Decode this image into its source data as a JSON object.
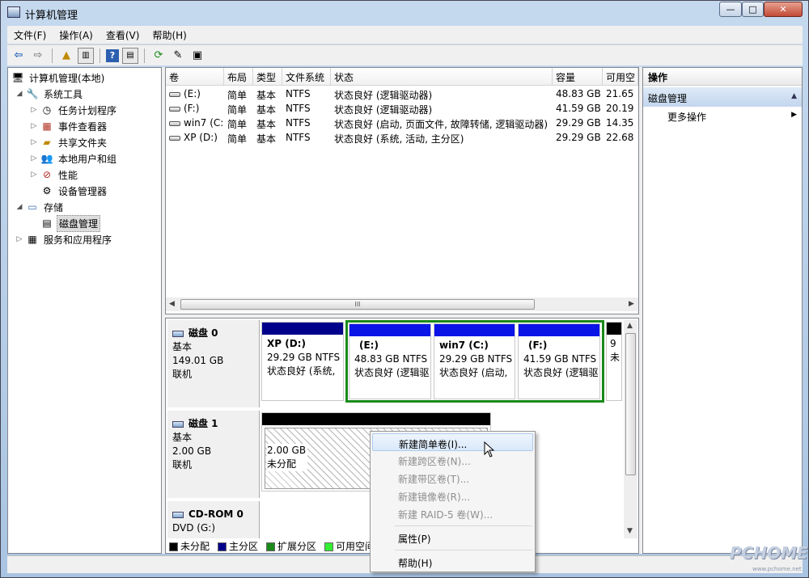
{
  "window": {
    "title": "计算机管理",
    "min": "—",
    "max": "□",
    "close": "✕"
  },
  "menu": [
    "文件(F)",
    "操作(A)",
    "查看(V)",
    "帮助(H)"
  ],
  "tree": [
    {
      "label": "计算机管理(本地)",
      "icon": "computer-icon"
    },
    {
      "label": "系统工具",
      "icon": "tools-icon",
      "exp": "◢"
    },
    {
      "label": "任务计划程序",
      "icon": "clock-icon",
      "exp": "▷"
    },
    {
      "label": "事件查看器",
      "icon": "event-viewer-icon",
      "exp": "▷"
    },
    {
      "label": "共享文件夹",
      "icon": "shared-folder-icon",
      "exp": "▷"
    },
    {
      "label": "本地用户和组",
      "icon": "users-icon",
      "exp": "▷"
    },
    {
      "label": "性能",
      "icon": "performance-icon",
      "exp": "▷"
    },
    {
      "label": "设备管理器",
      "icon": "device-manager-icon",
      "exp": ""
    },
    {
      "label": "存储",
      "icon": "storage-icon",
      "exp": "◢"
    },
    {
      "label": "磁盘管理",
      "icon": "disk-management-icon",
      "exp": ""
    },
    {
      "label": "服务和应用程序",
      "icon": "services-icon",
      "exp": "▷"
    }
  ],
  "volume_table": {
    "headers": [
      "卷",
      "布局",
      "类型",
      "文件系统",
      "状态",
      "容量",
      "可用空"
    ],
    "rows": [
      [
        "(E:)",
        "简单",
        "基本",
        "NTFS",
        "状态良好 (逻辑驱动器)",
        "48.83 GB",
        "21.65"
      ],
      [
        "(F:)",
        "简单",
        "基本",
        "NTFS",
        "状态良好 (逻辑驱动器)",
        "41.59 GB",
        "20.19"
      ],
      [
        "win7 (C:)",
        "简单",
        "基本",
        "NTFS",
        "状态良好 (启动, 页面文件, 故障转储, 逻辑驱动器)",
        "29.29 GB",
        "14.35"
      ],
      [
        "XP (D:)",
        "简单",
        "基本",
        "NTFS",
        "状态良好 (系统, 活动, 主分区)",
        "29.29 GB",
        "22.68"
      ]
    ],
    "scroll_thumb": "III"
  },
  "disks": {
    "disk0": {
      "name": "磁盘 0",
      "type": "基本",
      "size": "149.01 GB",
      "status": "联机"
    },
    "disk1": {
      "name": "磁盘 1",
      "type": "基本",
      "size": "2.00 GB",
      "status": "联机"
    },
    "cdrom": {
      "name": "CD-ROM 0",
      "type": "DVD (G:)"
    }
  },
  "partitions": [
    {
      "name": "XP  (D:)",
      "size": "29.29 GB NTFS",
      "status": "状态良好 (系统, "
    },
    {
      "name": "(E:)",
      "size": "48.83 GB NTFS",
      "status": "状态良好 (逻辑驱"
    },
    {
      "name": "win7  (C:)",
      "size": "29.29 GB NTFS",
      "status": "状态良好 (启动, "
    },
    {
      "name": "(F:)",
      "size": "41.59 GB NTFS",
      "status": "状态良好 (逻辑驱"
    },
    {
      "name": "",
      "size": "9",
      "status": "未"
    }
  ],
  "unallocated": {
    "size": "2.00 GB",
    "status": "未分配"
  },
  "legend": [
    {
      "label": "未分配",
      "color": "#000000"
    },
    {
      "label": "主分区",
      "color": "#00008b"
    },
    {
      "label": "扩展分区",
      "color": "#1a8a1a"
    },
    {
      "label": "可用空间",
      "color": "#33ee33"
    }
  ],
  "colors": {
    "primary": "#00008b",
    "logical": "#0a14e6",
    "extended": "#1a8a1a",
    "unallocated": "#000000"
  },
  "actions": {
    "header": "操作",
    "section": "磁盘管理",
    "more": "更多操作"
  },
  "context_menu": {
    "items": [
      {
        "label": "新建简单卷(I)...",
        "state": "highlighted"
      },
      {
        "label": "新建跨区卷(N)...",
        "state": "disabled"
      },
      {
        "label": "新建带区卷(T)...",
        "state": "disabled"
      },
      {
        "label": "新建镜像卷(R)...",
        "state": "disabled"
      },
      {
        "label": "新建 RAID-5 卷(W)...",
        "state": "disabled"
      },
      {
        "label": "属性(P)",
        "state": "enabled"
      },
      {
        "label": "帮助(H)",
        "state": "enabled"
      }
    ]
  },
  "watermark": {
    "logo": "PCHOME",
    "url": "www.pchome.net"
  }
}
